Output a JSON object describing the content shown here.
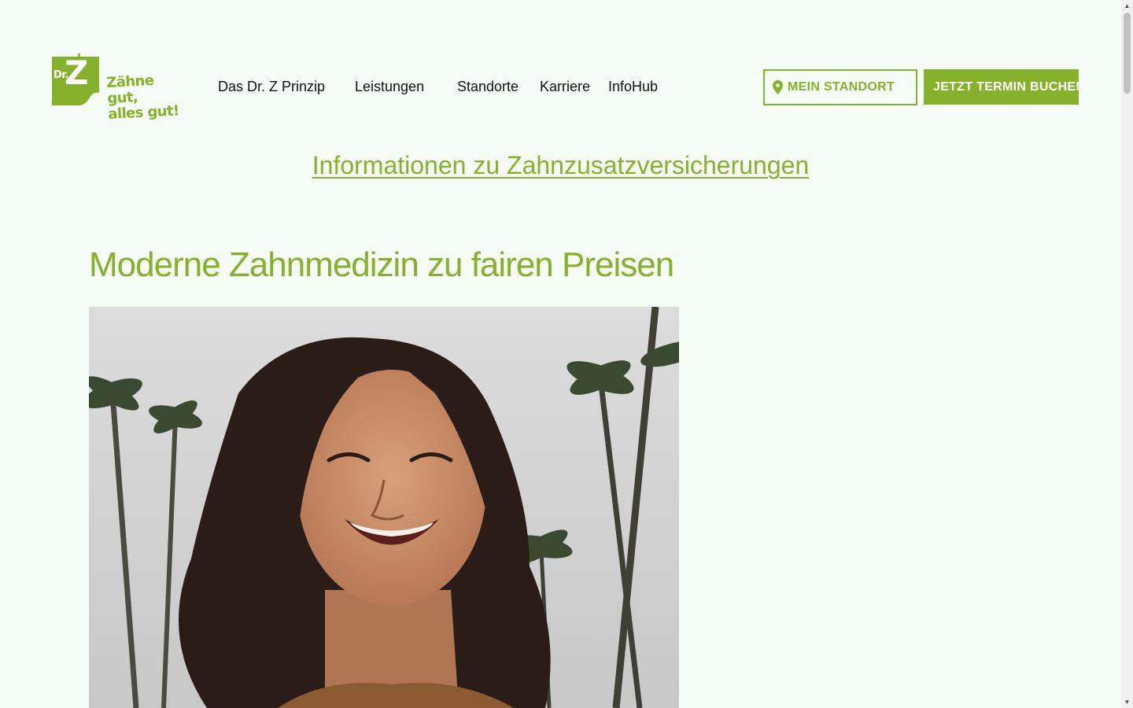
{
  "brand": {
    "logo_dr": "Dr.",
    "logo_z": "Z",
    "tagline_line1": "Zähne gut,",
    "tagline_line2": "alles gut!",
    "accent_color": "#85b22a"
  },
  "nav": {
    "items": [
      {
        "label": "Das Dr. Z Prinzip"
      },
      {
        "label": "Leistungen"
      },
      {
        "label": "Standorte"
      },
      {
        "label": "Karriere"
      },
      {
        "label": "InfoHub"
      }
    ]
  },
  "header_buttons": {
    "standort_label": "MEIN STANDORT",
    "standort_icon": "location-pin-icon",
    "termin_label": "JETZT TERMIN BUCHEN"
  },
  "main": {
    "info_link": "Informationen zu Zahnzusatzversicherungen",
    "headline": "Moderne Zahnmedizin zu fairen Preisen",
    "hero_image": "smiling-woman-with-palm-trees"
  }
}
